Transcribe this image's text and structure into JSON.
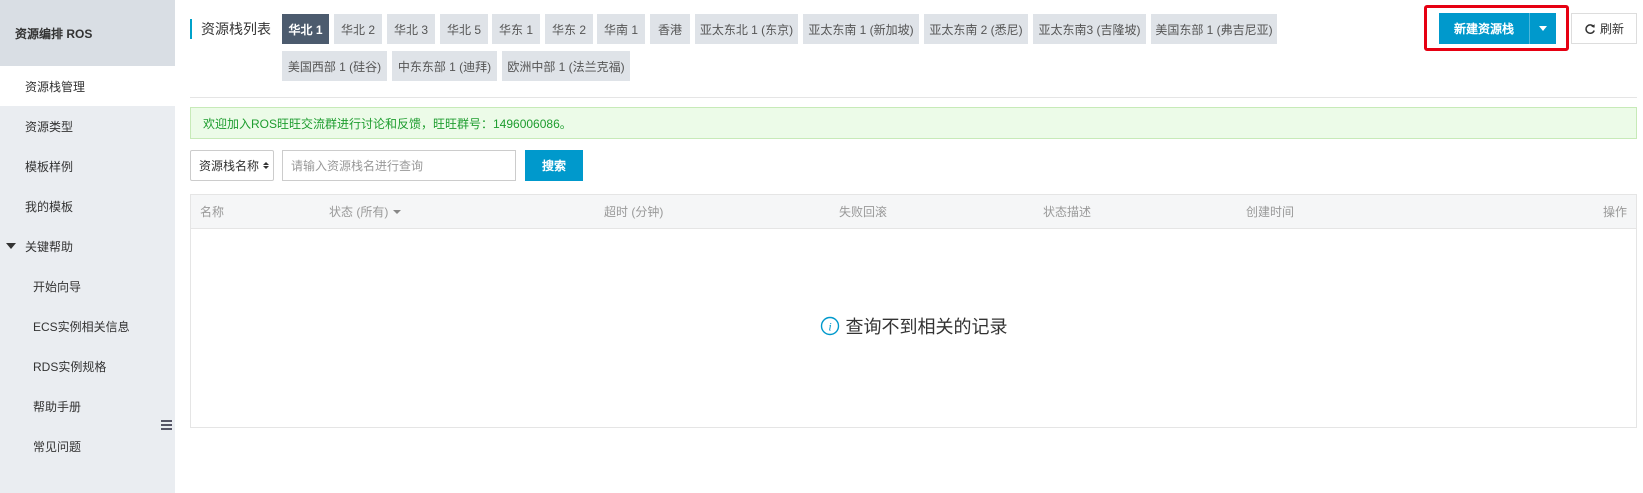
{
  "sidebar": {
    "title": "资源编排 ROS",
    "items": [
      {
        "label": "资源栈管理"
      },
      {
        "label": "资源类型"
      },
      {
        "label": "模板样例"
      },
      {
        "label": "我的模板"
      }
    ],
    "group": {
      "label": "关键帮助",
      "items": [
        {
          "label": "开始向导"
        },
        {
          "label": "ECS实例相关信息"
        },
        {
          "label": "RDS实例规格"
        },
        {
          "label": "帮助手册"
        },
        {
          "label": "常见问题"
        }
      ]
    }
  },
  "header": {
    "title": "资源栈列表",
    "regions": [
      "华北 1",
      "华北 2",
      "华北 3",
      "华北 5",
      "华东 1",
      "华东 2",
      "华南 1",
      "香港",
      "亚太东北 1 (东京)",
      "亚太东南 1 (新加坡)",
      "亚太东南 2 (悉尼)",
      "亚太东南3 (吉隆坡)",
      "美国东部 1 (弗吉尼亚)",
      "美国西部 1 (硅谷)",
      "中东东部 1 (迪拜)",
      "欧洲中部 1 (法兰克福)"
    ],
    "active_region": "华北 1",
    "create_label": "新建资源栈",
    "refresh_label": "刷新"
  },
  "notice": "欢迎加入ROS旺旺交流群进行讨论和反馈，旺旺群号：1496006086。",
  "search": {
    "select_value": "资源栈名称",
    "placeholder": "请输入资源栈名进行查询",
    "button_label": "搜索"
  },
  "table": {
    "columns": [
      "名称",
      "状态 (所有)",
      "超时 (分钟)",
      "失败回滚",
      "状态描述",
      "创建时间",
      "操作"
    ],
    "empty_text": "查询不到相关的记录"
  },
  "colors": {
    "accent": "#0099cc",
    "active_tab": "#4c5b6e",
    "highlight": "#e60012",
    "notice_text": "#1e9d2f"
  }
}
